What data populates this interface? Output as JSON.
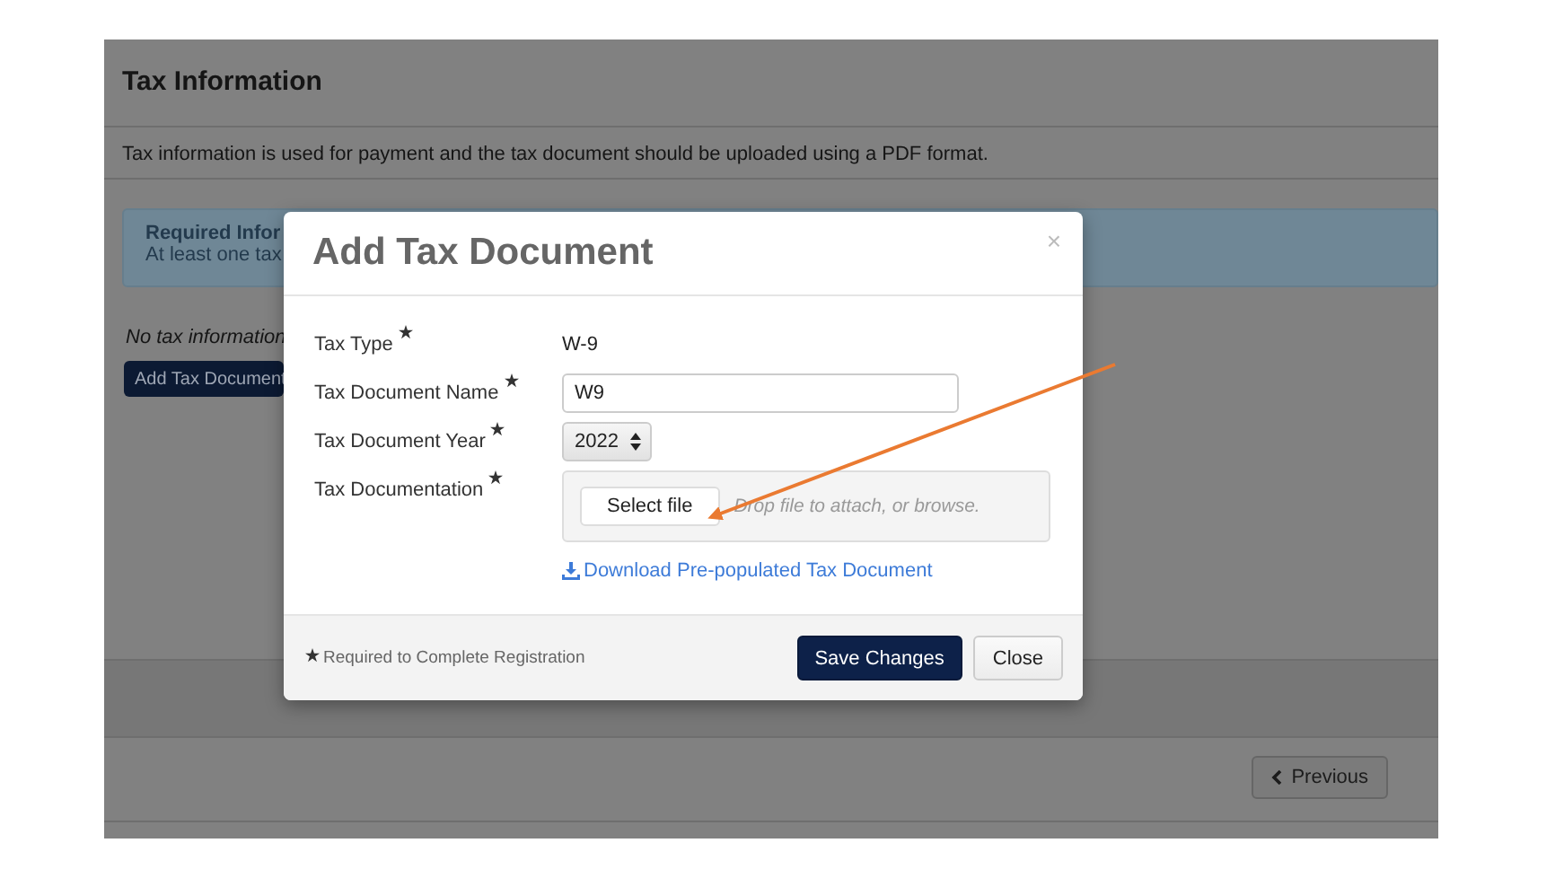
{
  "page": {
    "title": "Tax Information",
    "description": "Tax information is used for payment and the tax document should be uploaded using a PDF format.",
    "alert": {
      "title": "Required Infor",
      "text": "At least one tax"
    },
    "empty_note": "No tax information",
    "add_button": "Add Tax Document",
    "previous_button": "Previous"
  },
  "modal": {
    "title": "Add Tax Document",
    "close": "×",
    "fields": [
      {
        "kind": "text",
        "label": "Tax Type",
        "required": true,
        "value": "W-9"
      },
      {
        "kind": "input",
        "label": "Tax Document Name",
        "required": true,
        "value": "W9"
      },
      {
        "kind": "select",
        "label": "Tax Document Year",
        "required": true,
        "value": "2022"
      },
      {
        "kind": "file",
        "label": "Tax Documentation",
        "required": true,
        "button": "Select file",
        "placeholder": "Drop file to attach, or browse."
      }
    ],
    "download_link": "Download Pre-populated Tax Document",
    "footnote": "Required to Complete Registration",
    "buttons": [
      {
        "label": "Save Changes",
        "primary": true
      },
      {
        "label": "Close",
        "primary": false
      }
    ]
  }
}
